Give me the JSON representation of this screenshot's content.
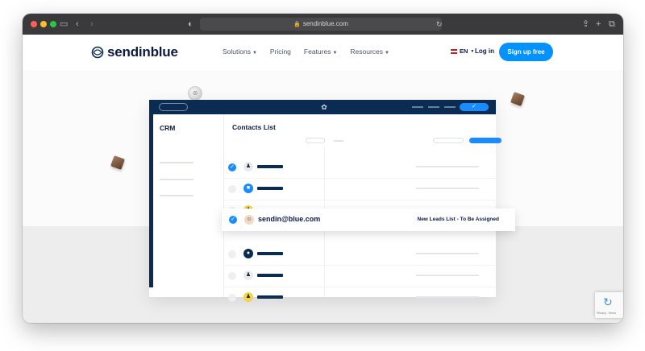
{
  "browser": {
    "url": "sendinblue.com"
  },
  "nav": {
    "brand": "sendinblue",
    "menu": [
      {
        "label": "Solutions",
        "dropdown": true
      },
      {
        "label": "Pricing",
        "dropdown": false
      },
      {
        "label": "Features",
        "dropdown": true
      },
      {
        "label": "Resources",
        "dropdown": true
      }
    ],
    "language": "EN",
    "login": "Log in",
    "signup": "Sign up free"
  },
  "app": {
    "sidebar_title": "CRM",
    "main_title": "Contacts List",
    "rows": [
      {
        "checked": true
      },
      {
        "checked": false
      },
      {
        "checked": false
      },
      {
        "checked": true,
        "highlight": true
      },
      {
        "checked": false
      },
      {
        "checked": false
      },
      {
        "checked": false
      }
    ],
    "highlight": {
      "email": "sendin@blue.com",
      "list": "New Leads List - To Be Assigned"
    }
  },
  "recaptcha": {
    "links": "Privacy - Terms"
  },
  "colors": {
    "brand_blue": "#0092ff",
    "navy": "#0b2c52",
    "text_dark": "#0b1a40"
  }
}
